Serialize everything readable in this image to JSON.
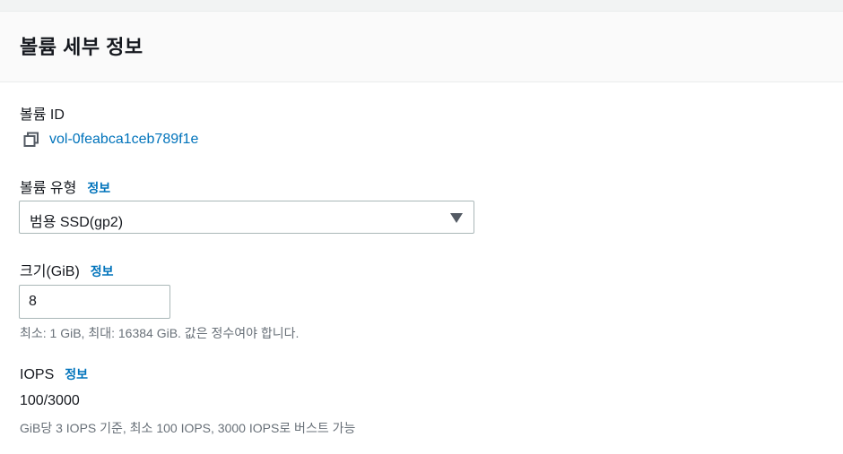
{
  "header": {
    "title": "볼륨 세부 정보"
  },
  "volume_id": {
    "label": "볼륨 ID",
    "value": "vol-0feabca1ceb789f1e"
  },
  "volume_type": {
    "label": "볼륨 유형",
    "info_link": "정보",
    "selected": "범용 SSD(gp2)"
  },
  "size": {
    "label": "크기(GiB)",
    "info_link": "정보",
    "value": "8",
    "hint": "최소: 1 GiB, 최대: 16384 GiB. 값은 정수여야 합니다."
  },
  "iops": {
    "label": "IOPS",
    "info_link": "정보",
    "value": "100/3000",
    "hint": "GiB당 3 IOPS 기준, 최소 100 IOPS, 3000 IOPS로 버스트 가능"
  },
  "colors": {
    "link": "#0073bb",
    "text": "#16191f",
    "muted": "#687078",
    "border": "#aab7b8"
  },
  "icons": {
    "copy": "copy-icon",
    "dropdown": "caret-down-icon"
  }
}
